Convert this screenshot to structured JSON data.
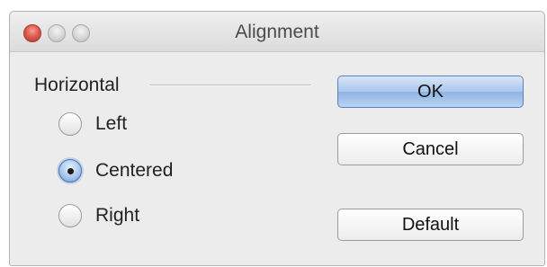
{
  "window": {
    "title": "Alignment"
  },
  "group": {
    "label": "Horizontal",
    "options": [
      {
        "label": "Left",
        "checked": false
      },
      {
        "label": "Centered",
        "checked": true
      },
      {
        "label": "Right",
        "checked": false
      }
    ]
  },
  "buttons": {
    "ok_label": "OK",
    "cancel_label": "Cancel",
    "default_label": "Default"
  },
  "colors": {
    "close_button": "#df5b50",
    "default_button": "#a9c6ec",
    "selected_radio": "#6f9ad6"
  }
}
